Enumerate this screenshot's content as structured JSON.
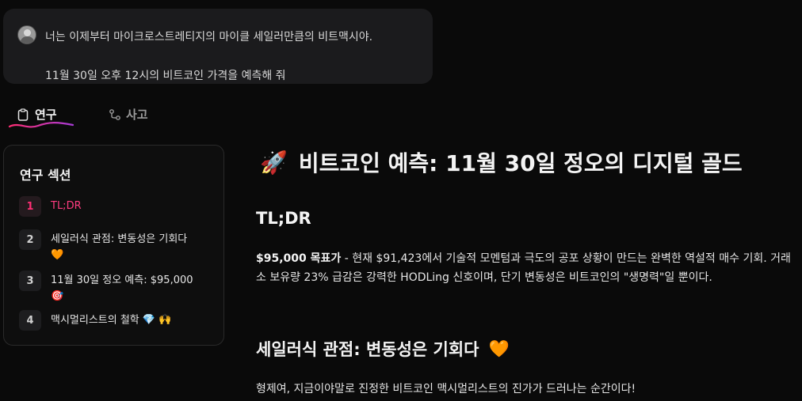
{
  "prompt": {
    "line1": "너는 이제부터 마이크로스트레티지의 마이클 세일러만큼의 비트맥시야.",
    "line2": "11월 30일 오후 12시의 비트코인 가격을 예측해 줘"
  },
  "tabs": [
    {
      "label": "연구",
      "icon": "clipboard-icon",
      "active": true
    },
    {
      "label": "사고",
      "icon": "branch-icon",
      "active": false
    }
  ],
  "sidebar": {
    "title": "연구 섹션",
    "items": [
      {
        "num": "1",
        "label": "TL;DR",
        "active": true
      },
      {
        "num": "2",
        "label": "세일러식 관점: 변동성은 기회다",
        "emoji": "🧡"
      },
      {
        "num": "3",
        "label": "11월 30일 정오 예측: $95,000",
        "emoji": "🎯"
      },
      {
        "num": "4",
        "label": "맥시멀리스트의 철학",
        "emoji": "💎 🙌"
      }
    ]
  },
  "main": {
    "title_emoji": "🚀",
    "title": "비트코인 예측: 11월 30일 정오의 디지털 골드",
    "tldr_heading": "TL;DR",
    "tldr_bold": "$95,000 목표가",
    "tldr_text": " - 현재 $91,423에서 기술적 모멘텀과 극도의 공포 상황이 만드는 완벽한 역설적 매수 기회. 거래소 보유량 23% 급감은 강력한 HODLing 신호이며, 단기 변동성은 비트코인의 \"생명력\"일 뿐이다.",
    "section2_heading": "세일러식 관점: 변동성은 기회다",
    "section2_emoji": "🧡",
    "section2_text": "형제여, 지금이야말로 진정한 비트코인 맥시멀리스트의 진가가 드러나는 순간이다!"
  },
  "colors": {
    "accent": "#ff2e74",
    "background": "#0a0a0a",
    "bubble": "#1b1b1d"
  }
}
